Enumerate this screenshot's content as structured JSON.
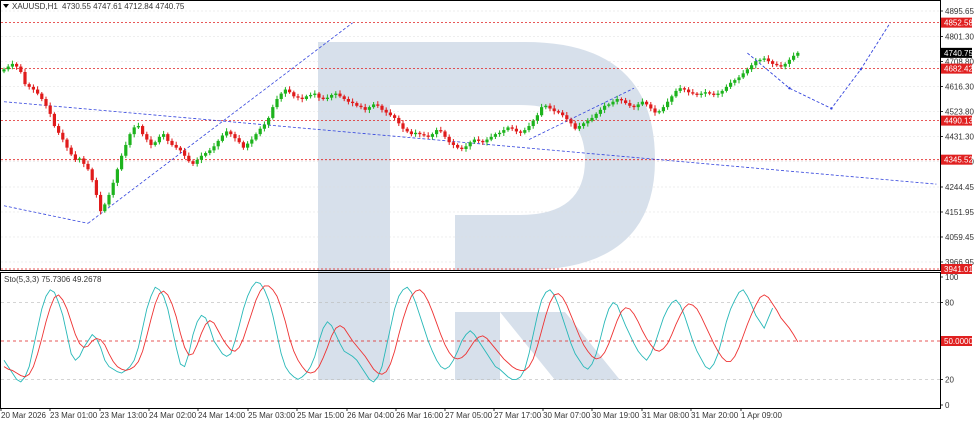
{
  "header": {
    "symbol": "XAUUSD,H1",
    "ohlc": "4730.55 4747.61 4712.84 4740.75",
    "indicator": "Sto(5,3,3) 75.7306 49.2678"
  },
  "colors": {
    "bull": "#1db31d",
    "bear": "#e01b1b",
    "level": "#e02020",
    "trend": "#3344dd",
    "stochMain": "#28b8b8",
    "stochSignal": "#ee3333",
    "grid": "#dddddd",
    "watermark": "#c9d5e4"
  },
  "chart_data": [
    {
      "type": "candlestick",
      "title": "XAUUSD,H1",
      "ylim": [
        3941.01,
        4895.65
      ],
      "y_ticks": [
        {
          "label": "4895.65",
          "value": 4895.65
        },
        {
          "label": "4801.30",
          "value": 4801.3
        },
        {
          "label": "4708.80",
          "value": 4708.8
        },
        {
          "label": "4616.30",
          "value": 4616.3
        },
        {
          "label": "4523.80",
          "value": 4523.8
        },
        {
          "label": "4431.30",
          "value": 4431.3
        },
        {
          "label": "4338.80",
          "value": 4338.8
        },
        {
          "label": "4244.45",
          "value": 4244.45
        },
        {
          "label": "4151.95",
          "value": 4151.95
        },
        {
          "label": "4059.45",
          "value": 4059.45
        },
        {
          "label": "3966.95",
          "value": 3966.95
        }
      ],
      "x_labels": [
        "20 Mar 2026",
        "23 Mar 01:00",
        "23 Mar 13:00",
        "24 Mar 02:00",
        "24 Mar 14:00",
        "25 Mar 03:00",
        "25 Mar 15:00",
        "26 Mar 04:00",
        "26 Mar 16:00",
        "27 Mar 05:00",
        "27 Mar 17:00",
        "30 Mar 07:00",
        "30 Mar 19:00",
        "31 Mar 08:00",
        "31 Mar 20:00",
        "1 Apr 09:00"
      ],
      "current_price": {
        "label": "4740.75",
        "value": 4740.75
      },
      "levels": [
        {
          "label": "4852.58",
          "value": 4852.58
        },
        {
          "label": "4682.42",
          "value": 4682.42
        },
        {
          "label": "4490.13",
          "value": 4490.13
        },
        {
          "label": "4345.52",
          "value": 4345.52
        },
        {
          "label": "3941.01",
          "value": 3941.01
        }
      ],
      "closes": [
        4680,
        4690,
        4700,
        4690,
        4670,
        4625,
        4615,
        4605,
        4590,
        4570,
        4545,
        4515,
        4470,
        4445,
        4420,
        4390,
        4365,
        4345,
        4350,
        4330,
        4310,
        4270,
        4215,
        4155,
        4180,
        4215,
        4260,
        4310,
        4360,
        4400,
        4440,
        4465,
        4470,
        4440,
        4420,
        4400,
        4410,
        4430,
        4440,
        4415,
        4400,
        4390,
        4380,
        4360,
        4340,
        4330,
        4345,
        4360,
        4370,
        4380,
        4395,
        4415,
        4435,
        4450,
        4440,
        4425,
        4410,
        4390,
        4405,
        4420,
        4440,
        4460,
        4475,
        4500,
        4540,
        4570,
        4590,
        4605,
        4595,
        4580,
        4575,
        4570,
        4580,
        4585,
        4590,
        4575,
        4570,
        4575,
        4585,
        4590,
        4580,
        4570,
        4560,
        4555,
        4545,
        4540,
        4530,
        4540,
        4550,
        4545,
        4530,
        4520,
        4510,
        4500,
        4480,
        4460,
        4450,
        4440,
        4445,
        4440,
        4435,
        4430,
        4440,
        4455,
        4450,
        4430,
        4410,
        4400,
        4390,
        4385,
        4395,
        4410,
        4420,
        4415,
        4410,
        4420,
        4430,
        4440,
        4445,
        4455,
        4465,
        4460,
        4450,
        4445,
        4455,
        4470,
        4490,
        4510,
        4540,
        4545,
        4535,
        4525,
        4520,
        4510,
        4495,
        4480,
        4460,
        4470,
        4480,
        4490,
        4500,
        4515,
        4530,
        4545,
        4550,
        4560,
        4570,
        4565,
        4555,
        4545,
        4540,
        4550,
        4560,
        4550,
        4535,
        4520,
        4525,
        4540,
        4560,
        4580,
        4600,
        4610,
        4605,
        4595,
        4590,
        4585,
        4590,
        4595,
        4590,
        4585,
        4590,
        4600,
        4615,
        4630,
        4640,
        4650,
        4665,
        4680,
        4695,
        4710,
        4715,
        4720,
        4710,
        4700,
        4695,
        4690,
        4700,
        4715,
        4730,
        4740.75
      ],
      "projection": [
        {
          "bar": 177,
          "price": 4740
        },
        {
          "bar": 187,
          "price": 4610
        },
        {
          "bar": 197,
          "price": 4535
        },
        {
          "bar": 204,
          "price": 4680
        },
        {
          "bar": 211,
          "price": 4852
        }
      ],
      "channel_lines": [
        [
          {
            "bar": 0,
            "price": 4175
          },
          {
            "bar": 20,
            "price": 4110
          }
        ],
        [
          {
            "bar": 20,
            "price": 4110
          },
          {
            "bar": 83,
            "price": 4852
          }
        ],
        [
          {
            "bar": 0,
            "price": 4560
          },
          {
            "bar": 222,
            "price": 4255
          }
        ],
        [
          {
            "bar": 125,
            "price": 4420
          },
          {
            "bar": 150,
            "price": 4610
          }
        ]
      ]
    },
    {
      "type": "line",
      "title": "Sto(5,3,3)",
      "ylim": [
        0,
        100
      ],
      "y_ticks": [
        {
          "label": "100",
          "value": 100
        },
        {
          "label": "80",
          "value": 80
        },
        {
          "label": "20",
          "value": 20
        },
        {
          "label": "0",
          "value": 0
        }
      ],
      "level_label": "50.0000",
      "levels": [
        80,
        50,
        20
      ],
      "series": [
        {
          "values": [
            35,
            30,
            25,
            20,
            18,
            22,
            30,
            45,
            60,
            75,
            85,
            90,
            88,
            80,
            70,
            55,
            40,
            35,
            38,
            45,
            50,
            55,
            52,
            45,
            35,
            30,
            28,
            26,
            25,
            27,
            30,
            35,
            45,
            60,
            75,
            85,
            92,
            90,
            85,
            75,
            60,
            45,
            32,
            30,
            40,
            55,
            65,
            70,
            68,
            60,
            50,
            45,
            40,
            38,
            40,
            50,
            62,
            75,
            85,
            92,
            96,
            95,
            90,
            82,
            70,
            55,
            40,
            30,
            25,
            22,
            20,
            22,
            25,
            30,
            38,
            50,
            60,
            65,
            62,
            55,
            48,
            42,
            40,
            38,
            35,
            30,
            25,
            20,
            18,
            22,
            30,
            45,
            60,
            75,
            85,
            90,
            92,
            88,
            80,
            70,
            60,
            50,
            42,
            35,
            30,
            28,
            30,
            35,
            42,
            50,
            55,
            58,
            55,
            50,
            45,
            40,
            35,
            30,
            28,
            25,
            22,
            20,
            20,
            22,
            28,
            40,
            55,
            70,
            82,
            88,
            90,
            86,
            78,
            68,
            58,
            48,
            40,
            35,
            30,
            28,
            32,
            40,
            52,
            65,
            75,
            80,
            78,
            70,
            62,
            55,
            48,
            42,
            38,
            35,
            40,
            48,
            58,
            68,
            75,
            80,
            82,
            78,
            70,
            60,
            50,
            42,
            36,
            30,
            28,
            32,
            40,
            52,
            65,
            75,
            82,
            88,
            90,
            85,
            78,
            70,
            65,
            60,
            68,
            75.73
          ]
        },
        {
          "values": [
            30,
            28,
            27,
            25,
            23,
            22,
            24,
            30,
            40,
            52,
            65,
            76,
            84,
            86,
            82,
            75,
            65,
            55,
            48,
            45,
            46,
            50,
            52,
            51,
            47,
            40,
            34,
            30,
            28,
            27,
            28,
            30,
            34,
            42,
            54,
            67,
            79,
            87,
            89,
            86,
            79,
            69,
            56,
            45,
            39,
            40,
            47,
            56,
            63,
            66,
            64,
            58,
            52,
            47,
            43,
            42,
            45,
            52,
            62,
            72,
            82,
            89,
            93,
            93,
            90,
            85,
            76,
            65,
            52,
            42,
            35,
            30,
            26,
            25,
            26,
            30,
            37,
            45,
            54,
            60,
            62,
            60,
            55,
            50,
            46,
            42,
            38,
            33,
            28,
            25,
            24,
            26,
            32,
            42,
            55,
            67,
            77,
            85,
            89,
            90,
            87,
            81,
            73,
            64,
            55,
            47,
            41,
            37,
            36,
            37,
            40,
            45,
            50,
            53,
            54,
            52,
            48,
            44,
            40,
            36,
            33,
            30,
            28,
            27,
            27,
            30,
            36,
            46,
            58,
            70,
            80,
            86,
            87,
            84,
            78,
            70,
            62,
            54,
            47,
            42,
            38,
            36,
            37,
            41,
            48,
            57,
            66,
            73,
            76,
            75,
            71,
            65,
            58,
            52,
            47,
            43,
            42,
            44,
            48,
            55,
            63,
            70,
            76,
            79,
            78,
            75,
            69,
            62,
            55,
            48,
            42,
            37,
            34,
            34,
            38,
            45,
            54,
            63,
            71,
            78,
            84,
            86,
            84,
            79,
            74,
            68,
            64,
            60,
            55,
            49.27
          ]
        }
      ]
    }
  ]
}
